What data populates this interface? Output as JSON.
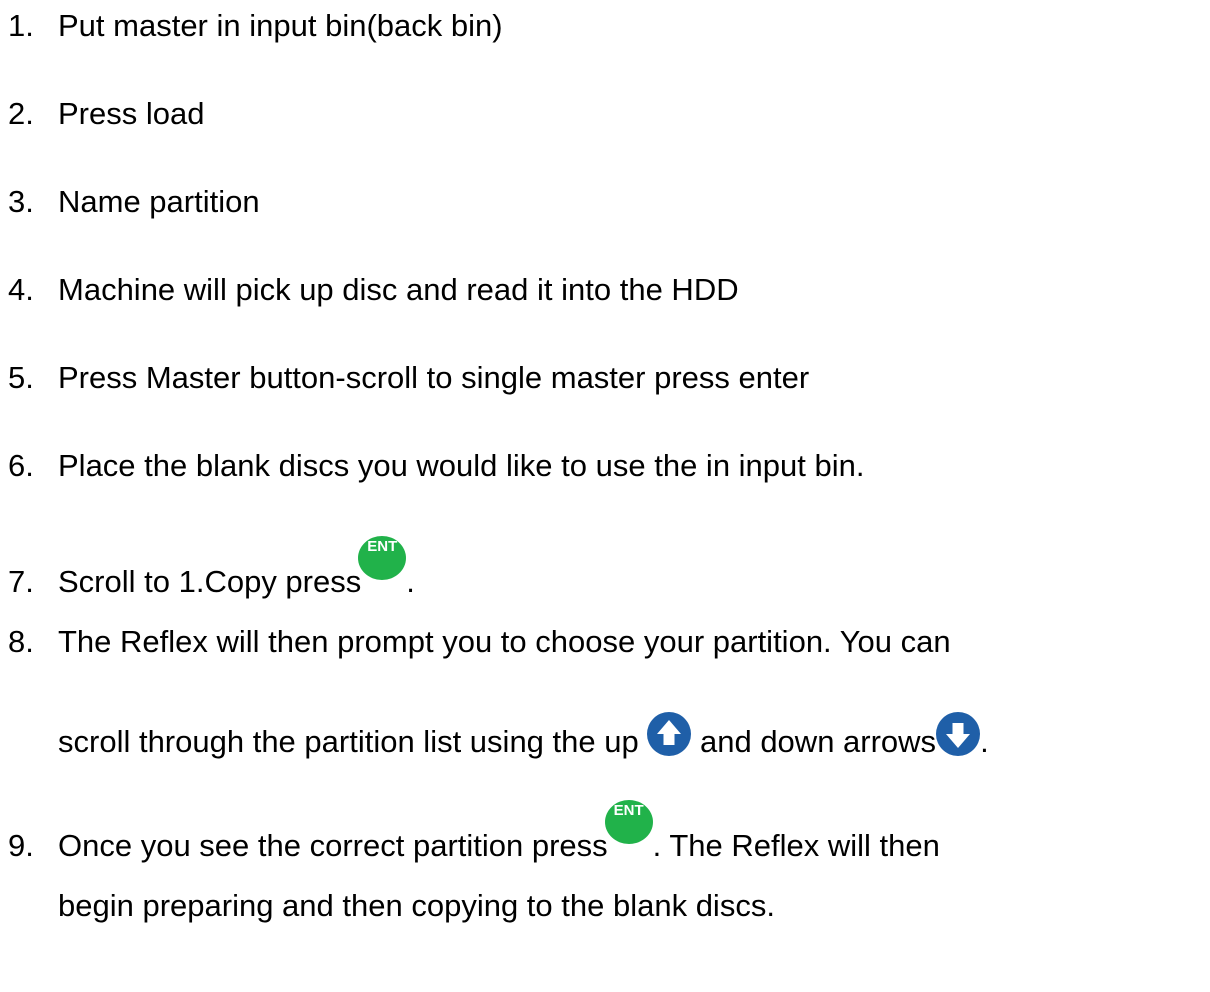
{
  "steps": [
    {
      "num": "1.",
      "text": "Put master in input bin(back bin)"
    },
    {
      "num": "2.",
      "text": "Press load"
    },
    {
      "num": "3.",
      "text": "Name partition"
    },
    {
      "num": "4.",
      "text": "Machine will pick up disc and read it into the HDD"
    },
    {
      "num": "5.",
      "text": "Press Master button-scroll to single master press enter"
    },
    {
      "num": "6.",
      "text": "Place the blank discs you would like to use the in input bin."
    },
    {
      "num": "7.",
      "text_before": "Scroll to 1.Copy press",
      "text_after": "."
    },
    {
      "num": "8.",
      "line1": "The Reflex will then prompt you to choose your partition. You can",
      "line2_before": "scroll through the partition list using the up",
      "line2_middle": "and down arrows",
      "line2_after": "."
    },
    {
      "num": "9.",
      "line1_before": "Once you see the correct partition press",
      "line1_after": ". The Reflex will then",
      "line2": "begin preparing and then copying to the blank discs."
    }
  ],
  "icons": {
    "ent_label": "ENT",
    "ent_color": "#21b24a",
    "arrow_color": "#1f5fa8",
    "up_arrow": "up-arrow-icon",
    "down_arrow": "down-arrow-icon"
  }
}
